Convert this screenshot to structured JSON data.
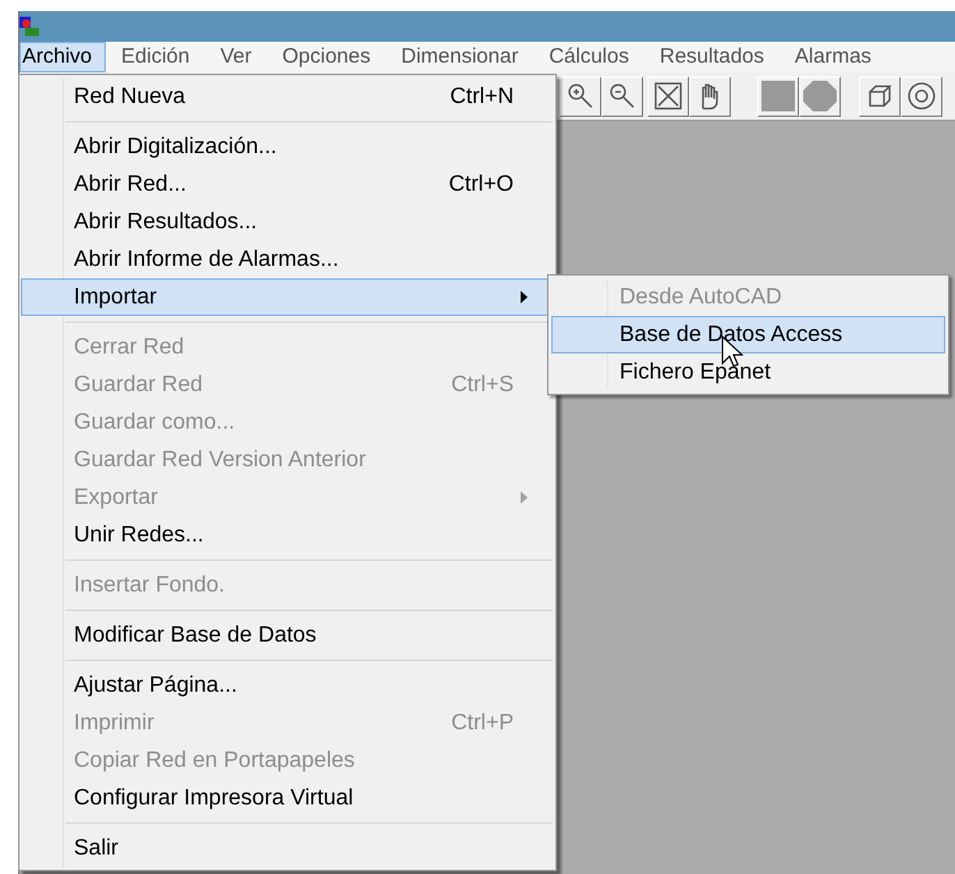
{
  "menu_bar": [
    {
      "label": "Archivo",
      "selected": true
    },
    {
      "label": "Edición",
      "selected": false
    },
    {
      "label": "Ver",
      "selected": false
    },
    {
      "label": "Opciones",
      "selected": false
    },
    {
      "label": "Dimensionar",
      "selected": false
    },
    {
      "label": "Cálculos",
      "selected": false
    },
    {
      "label": "Resultados",
      "selected": false
    },
    {
      "label": "Alarmas",
      "selected": false
    }
  ],
  "file_menu": [
    {
      "kind": "item",
      "label": "Red Nueva",
      "shortcut": "Ctrl+N",
      "disabled": false,
      "selected": false,
      "submenu": false
    },
    {
      "kind": "separator"
    },
    {
      "kind": "item",
      "label": "Abrir Digitalización...",
      "disabled": false,
      "selected": false,
      "submenu": false
    },
    {
      "kind": "item",
      "label": "Abrir Red...",
      "shortcut": "Ctrl+O",
      "disabled": false,
      "selected": false,
      "submenu": false
    },
    {
      "kind": "item",
      "label": "Abrir Resultados...",
      "disabled": false,
      "selected": false,
      "submenu": false
    },
    {
      "kind": "item",
      "label": "Abrir Informe de Alarmas...",
      "disabled": false,
      "selected": false,
      "submenu": false
    },
    {
      "kind": "item",
      "label": "Importar",
      "disabled": false,
      "selected": true,
      "submenu": true
    },
    {
      "kind": "separator"
    },
    {
      "kind": "item",
      "label": "Cerrar Red",
      "disabled": true,
      "selected": false,
      "submenu": false
    },
    {
      "kind": "item",
      "label": "Guardar Red",
      "shortcut": "Ctrl+S",
      "disabled": true,
      "selected": false,
      "submenu": false
    },
    {
      "kind": "item",
      "label": "Guardar como...",
      "disabled": true,
      "selected": false,
      "submenu": false
    },
    {
      "kind": "item",
      "label": "Guardar Red Version Anterior",
      "disabled": true,
      "selected": false,
      "submenu": false
    },
    {
      "kind": "item",
      "label": "Exportar",
      "disabled": true,
      "selected": false,
      "submenu": true
    },
    {
      "kind": "item",
      "label": "Unir Redes...",
      "disabled": false,
      "selected": false,
      "submenu": false
    },
    {
      "kind": "separator"
    },
    {
      "kind": "item",
      "label": "Insertar Fondo.",
      "disabled": true,
      "selected": false,
      "submenu": false
    },
    {
      "kind": "separator"
    },
    {
      "kind": "item",
      "label": "Modificar Base de Datos",
      "disabled": false,
      "selected": false,
      "submenu": false
    },
    {
      "kind": "separator"
    },
    {
      "kind": "item",
      "label": "Ajustar Página...",
      "disabled": false,
      "selected": false,
      "submenu": false
    },
    {
      "kind": "item",
      "label": "Imprimir",
      "shortcut": "Ctrl+P",
      "disabled": true,
      "selected": false,
      "submenu": false
    },
    {
      "kind": "item",
      "label": "Copiar Red en Portapapeles",
      "disabled": true,
      "selected": false,
      "submenu": false
    },
    {
      "kind": "item",
      "label": "Configurar Impresora Virtual",
      "disabled": false,
      "selected": false,
      "submenu": false
    },
    {
      "kind": "separator"
    },
    {
      "kind": "item",
      "label": "Salir",
      "disabled": false,
      "selected": false,
      "submenu": false
    }
  ],
  "import_submenu": [
    {
      "label": "Desde AutoCAD",
      "disabled": true,
      "selected": false
    },
    {
      "label": "Base de Datos Access",
      "disabled": false,
      "selected": true
    },
    {
      "label": "Fichero Epanet",
      "disabled": false,
      "selected": false
    }
  ]
}
